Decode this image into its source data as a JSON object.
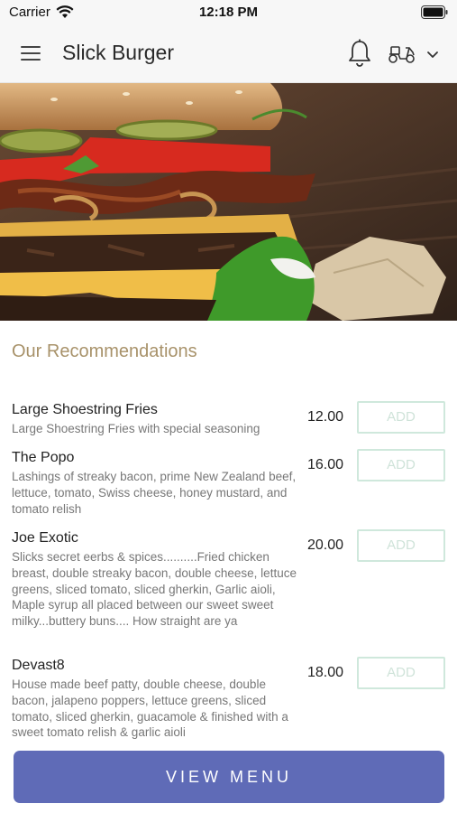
{
  "status_bar": {
    "carrier": "Carrier",
    "time": "12:18 PM"
  },
  "header": {
    "title": "Slick Burger"
  },
  "section": {
    "title": "Our Recommendations"
  },
  "items": [
    {
      "name": "Large Shoestring Fries",
      "description": "Large Shoestring Fries with special seasoning",
      "price": "12.00",
      "add_label": "ADD"
    },
    {
      "name": "The Popo",
      "description": "Lashings of streaky bacon, prime New Zealand beef, lettuce, tomato, Swiss cheese, honey mustard, and tomato relish",
      "price": "16.00",
      "add_label": "ADD"
    },
    {
      "name": "Joe Exotic",
      "description": "Slicks secret eerbs & spices..........Fried chicken breast, double streaky bacon, double cheese, lettuce greens, sliced tomato, sliced gherkin, Garlic aioli, Maple syrup all placed between our sweet sweet milky...buttery buns.... How straight are ya",
      "price": "20.00",
      "add_label": "ADD"
    },
    {
      "name": "Devast8",
      "description": "House made beef patty, double cheese, double bacon, jalapeno poppers, lettuce greens, sliced tomato, sliced gherkin, guacamole & finished with a sweet tomato relish & garlic aioli",
      "price": "18.00",
      "add_label": "ADD"
    }
  ],
  "footer": {
    "view_menu_label": "VIEW MENU"
  },
  "colors": {
    "accent": "#5f6bb7",
    "section_title": "#a8926a",
    "add_border": "#cfe8dc"
  },
  "icons": [
    "menu-icon",
    "bell-icon",
    "scooter-icon",
    "chevron-down-icon",
    "wifi-icon",
    "battery-icon"
  ]
}
